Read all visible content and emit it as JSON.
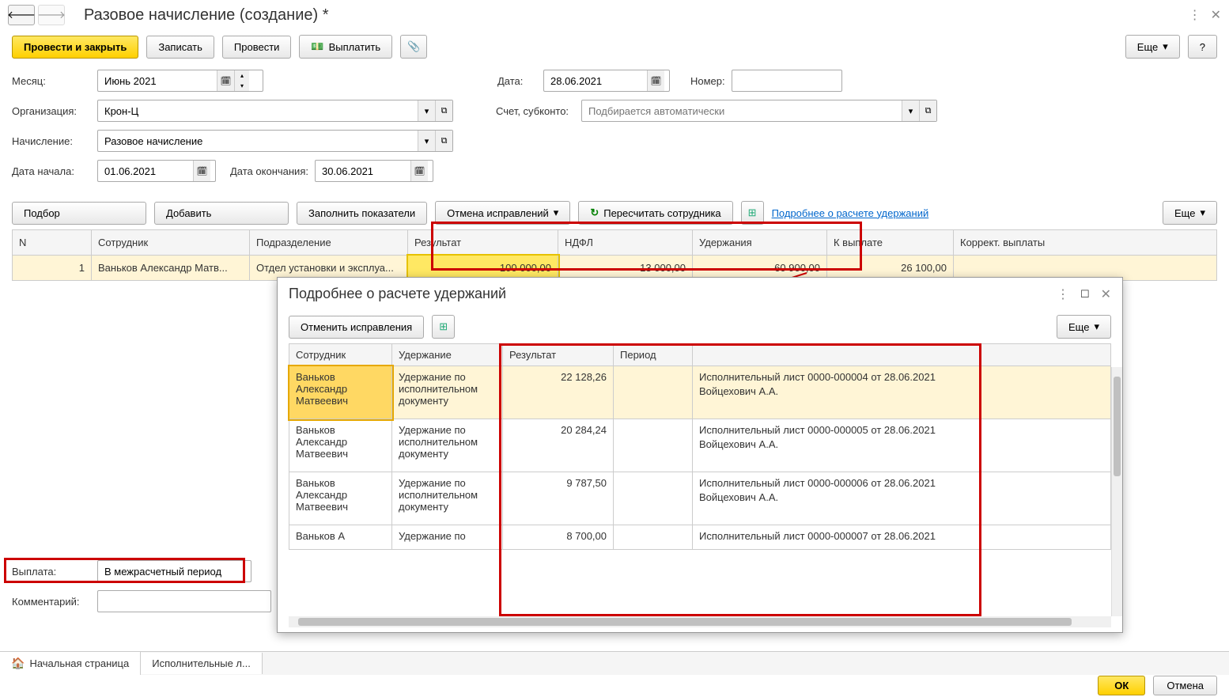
{
  "title": "Разовое начисление (создание) *",
  "toolbar": {
    "post_close": "Провести и закрыть",
    "save": "Записать",
    "post": "Провести",
    "pay": "Выплатить",
    "more": "Еще",
    "help": "?"
  },
  "form": {
    "month_label": "Месяц:",
    "month_value": "Июнь 2021",
    "date_label": "Дата:",
    "date_value": "28.06.2021",
    "number_label": "Номер:",
    "number_value": "",
    "org_label": "Организация:",
    "org_value": "Крон-Ц",
    "account_label": "Счет, субконто:",
    "account_placeholder": "Подбирается автоматически",
    "accrual_label": "Начисление:",
    "accrual_value": "Разовое начисление",
    "start_label": "Дата начала:",
    "start_value": "01.06.2021",
    "end_label": "Дата окончания:",
    "end_value": "30.06.2021"
  },
  "actions": {
    "select": "Подбор",
    "add": "Добавить",
    "fill": "Заполнить показатели",
    "cancel_fix": "Отмена исправлений",
    "recalc": "Пересчитать сотрудника",
    "detail_link": "Подробнее о расчете удержаний",
    "more": "Еще"
  },
  "table": {
    "headers": {
      "n": "N",
      "employee": "Сотрудник",
      "dept": "Подразделение",
      "result": "Результат",
      "ndfl": "НДФЛ",
      "deduction": "Удержания",
      "payout": "К выплате",
      "correct": "Коррект. выплаты"
    },
    "rows": [
      {
        "n": "1",
        "employee": "Ваньков Александр Матв...",
        "dept": "Отдел установки и эксплуа...",
        "result": "100 000,00",
        "ndfl": "13 000,00",
        "deduction": "60 900,00",
        "payout": "26 100,00",
        "correct": ""
      }
    ]
  },
  "popup": {
    "title": "Подробнее о расчете удержаний",
    "cancel_fix": "Отменить исправления",
    "more": "Еще",
    "headers": {
      "employee": "Сотрудник",
      "deduction": "Удержание",
      "result": "Результат",
      "period": "Период",
      "desc": ""
    },
    "rows": [
      {
        "employee": "Ваньков Александр Матвеевич",
        "deduction": "Удержание по исполнительном документу",
        "result": "22 128,26",
        "period": "",
        "desc1": "Исполнительный лист 0000-000004 от 28.06.2021",
        "desc2": "Войцехович А.А."
      },
      {
        "employee": "Ваньков Александр Матвеевич",
        "deduction": "Удержание по исполнительном документу",
        "result": "20 284,24",
        "period": "",
        "desc1": "Исполнительный лист 0000-000005 от 28.06.2021",
        "desc2": "Войцехович А.А."
      },
      {
        "employee": "Ваньков Александр Матвеевич",
        "deduction": "Удержание по исполнительном документу",
        "result": "9 787,50",
        "period": "",
        "desc1": "Исполнительный лист 0000-000006 от 28.06.2021",
        "desc2": "Войцехович А.А."
      },
      {
        "employee": "Ваньков А",
        "deduction": "Удержание по",
        "result": "8 700,00",
        "period": "",
        "desc1": "Исполнительный лист 0000-000007 от 28.06.2021",
        "desc2": ""
      }
    ]
  },
  "bottom": {
    "payout_label": "Выплата:",
    "payout_value": "В межрасчетный период",
    "comment_label": "Комментарий:",
    "comment_value": ""
  },
  "tabs": {
    "home": "Начальная страница",
    "exec": "Исполнительные л..."
  },
  "footer": {
    "ok": "ОК",
    "cancel": "Отмена"
  }
}
